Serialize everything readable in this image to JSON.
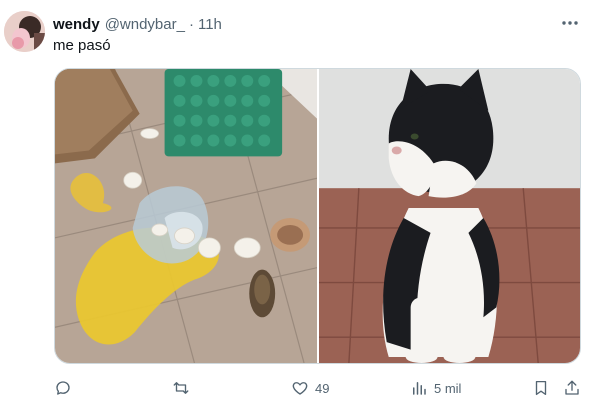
{
  "tweet": {
    "display_name": "wendy",
    "handle": "@wndybar_",
    "separator": "·",
    "time": "11h",
    "text": "me pasó"
  },
  "media": {
    "left_description": "broken eggs on tile floor",
    "right_description": "black and white cat"
  },
  "actions": {
    "reply_count": "",
    "retweet_count": "",
    "like_count": "49",
    "views_count": "5 mil"
  },
  "icons": {
    "more": "more-dots-icon",
    "reply": "reply-icon",
    "retweet": "retweet-icon",
    "like": "heart-icon",
    "views": "views-icon",
    "bookmark": "bookmark-icon",
    "share": "share-icon"
  },
  "colors": {
    "text_primary": "#0f1419",
    "text_secondary": "#536471",
    "border": "#cfd9de"
  }
}
